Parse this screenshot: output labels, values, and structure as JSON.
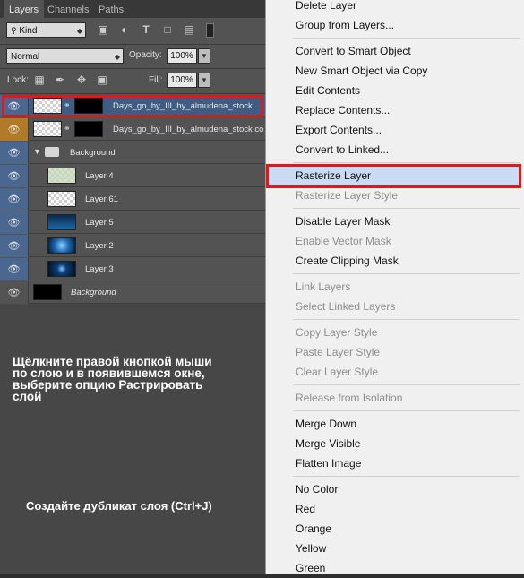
{
  "tabs": [
    "Layers",
    "Channels",
    "Paths"
  ],
  "filter": {
    "kind": "Kind"
  },
  "blend": {
    "mode": "Normal",
    "opacity_label": "Opacity:",
    "opacity_value": "100%"
  },
  "lock": {
    "label": "Lock:",
    "fill_label": "Fill:",
    "fill_value": "100%"
  },
  "layers": [
    {
      "name": "Days_go_by_III_by_almudena_stock"
    },
    {
      "name": "Days_go_by_III_by_almudena_stock copy"
    },
    {
      "name": "Background"
    },
    {
      "name": "Layer 4"
    },
    {
      "name": "Layer 61"
    },
    {
      "name": "Layer 5"
    },
    {
      "name": "Layer 2"
    },
    {
      "name": "Layer 3"
    },
    {
      "name": "Background"
    }
  ],
  "annotations": {
    "line1": "Щёлкните правой кнопкой мыши",
    "line2": "по слою и в появившемся окне,",
    "line3": "выберите опцию Растрировать",
    "line4": "слой",
    "dup": "Создайте дубликат слоя (Ctrl+J)"
  },
  "menu": {
    "items": [
      "Delete Layer",
      "Group from Layers...",
      "Convert to Smart Object",
      "New Smart Object via Copy",
      "Edit Contents",
      "Replace Contents...",
      "Export Contents...",
      "Convert to Linked...",
      "Rasterize Layer",
      "Rasterize Layer Style",
      "Disable Layer Mask",
      "Enable Vector Mask",
      "Create Clipping Mask",
      "Link Layers",
      "Select Linked Layers",
      "Copy Layer Style",
      "Paste Layer Style",
      "Clear Layer Style",
      "Release from Isolation",
      "Merge Down",
      "Merge Visible",
      "Flatten Image",
      "No Color",
      "Red",
      "Orange",
      "Yellow",
      "Green"
    ]
  },
  "colors": {
    "selection_blue": "#3f5c83",
    "highlight_red": "#e01818",
    "menu_hover": "#c9dcf3"
  }
}
